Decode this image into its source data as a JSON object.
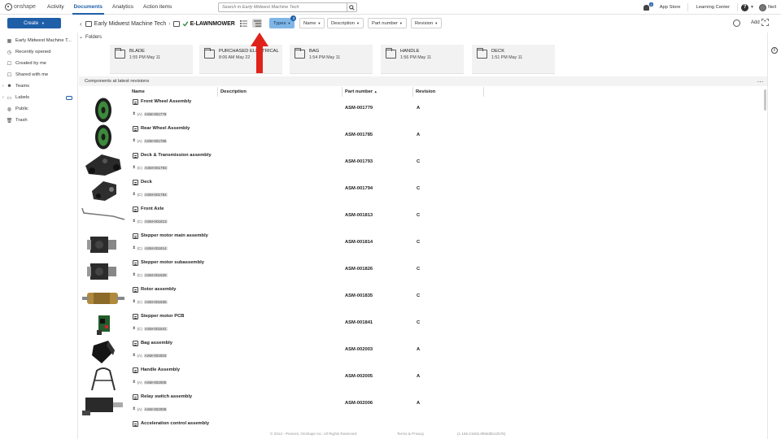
{
  "nav": {
    "logo": "onshape",
    "tabs": [
      "Activity",
      "Documents",
      "Analytics",
      "Action items"
    ],
    "active_tab": "Documents",
    "search_placeholder": "Search in Early Midwest Machine Tech",
    "notif_count": "8",
    "app_store": "App Store",
    "learning_center": "Learning Center",
    "help": "?",
    "user": "Neil"
  },
  "toolbar": {
    "create": "Create",
    "breadcrumb_root": "Early Midwest Machine Tech",
    "breadcrumb_current": "E-LAWNMOWER",
    "filters": {
      "types": "Types",
      "types_badge": "3",
      "name": "Name",
      "description": "Description",
      "part_number": "Part number",
      "revision": "Revision"
    },
    "add": "Add"
  },
  "sidebar": {
    "items": [
      {
        "label": "Early Midwest Machine T...",
        "icon": "building-icon"
      },
      {
        "label": "Recently opened",
        "icon": "clock-icon"
      },
      {
        "label": "Created by me",
        "icon": "person-icon"
      },
      {
        "label": "Shared with me",
        "icon": "shared-icon"
      },
      {
        "label": "Teams",
        "icon": "teams-icon"
      },
      {
        "label": "Labels",
        "icon": "label-icon"
      },
      {
        "label": "Public",
        "icon": "globe-icon"
      },
      {
        "label": "Trash",
        "icon": "trash-icon"
      }
    ]
  },
  "folders": {
    "heading": "Folders",
    "items": [
      {
        "name": "BLADE",
        "date": "1:55 PM May 11"
      },
      {
        "name": "PURCHASED ELECTRICAL",
        "date": "8:06 AM May 22"
      },
      {
        "name": "BAG",
        "date": "1:54 PM May 11"
      },
      {
        "name": "HANDLE",
        "date": "1:56 PM May 11"
      },
      {
        "name": "DECK",
        "date": "1:51 PM May 11"
      }
    ]
  },
  "components": {
    "heading": "Components at latest revisions",
    "more": "...",
    "columns": {
      "name": "Name",
      "description": "Description",
      "part_number": "Part number",
      "sort_indicator": "▲",
      "revision": "Revision"
    },
    "rows": [
      {
        "name": "Front Wheel Assembly",
        "rev_tag": "(A)",
        "pn_badge": "ASM-001779",
        "part_number": "ASM-001779",
        "revision": "A",
        "thumb": "wheel"
      },
      {
        "name": "Rear Wheel Assembly",
        "rev_tag": "(A)",
        "pn_badge": "ASM-001785",
        "part_number": "ASM-001785",
        "revision": "A",
        "thumb": "wheel"
      },
      {
        "name": "Deck & Transmission assembly",
        "rev_tag": "(C)",
        "pn_badge": "ASM-001793",
        "part_number": "ASM-001793",
        "revision": "C",
        "thumb": "deck"
      },
      {
        "name": "Deck",
        "rev_tag": "(C)",
        "pn_badge": "ASM-001794",
        "part_number": "ASM-001794",
        "revision": "C",
        "thumb": "deck2"
      },
      {
        "name": "Front Axle",
        "rev_tag": "(C)",
        "pn_badge": "ASM-001813",
        "part_number": "ASM-001813",
        "revision": "C",
        "thumb": "axle"
      },
      {
        "name": "Stepper motor main assembly",
        "rev_tag": "(C)",
        "pn_badge": "ASM-001814",
        "part_number": "ASM-001814",
        "revision": "C",
        "thumb": "motor"
      },
      {
        "name": "Stepper motor subassembly",
        "rev_tag": "(C)",
        "pn_badge": "ASM-001826",
        "part_number": "ASM-001826",
        "revision": "C",
        "thumb": "motor"
      },
      {
        "name": "Rotor assembly",
        "rev_tag": "(C)",
        "pn_badge": "ASM-001835",
        "part_number": "ASM-001835",
        "revision": "C",
        "thumb": "rotor"
      },
      {
        "name": "Stepper motor PCB",
        "rev_tag": "(C)",
        "pn_badge": "ASM-001841",
        "part_number": "ASM-001841",
        "revision": "C",
        "thumb": "pcb"
      },
      {
        "name": "Bag assembly",
        "rev_tag": "(A)",
        "pn_badge": "ASM-002003",
        "part_number": "ASM-002003",
        "revision": "A",
        "thumb": "bag"
      },
      {
        "name": "Handle Assembly",
        "rev_tag": "(A)",
        "pn_badge": "ASM-002005",
        "part_number": "ASM-002005",
        "revision": "A",
        "thumb": "handle"
      },
      {
        "name": "Relay switch assembly",
        "rev_tag": "(A)",
        "pn_badge": "ASM-002006",
        "part_number": "ASM-002006",
        "revision": "A",
        "thumb": "relay"
      },
      {
        "name": "Acceleration control assembly",
        "rev_tag": "",
        "pn_badge": "",
        "part_number": "",
        "revision": "",
        "thumb": "none"
      }
    ]
  },
  "footer": {
    "copyright": "© 2013 - Present, Onshape Inc. All Rights Reserved.",
    "terms": "Terms & Privacy",
    "version": "(1.169.21602.8f69d6b12b78)"
  },
  "colors": {
    "accent": "#1f5fa8",
    "types_filter": "#7fb6e6",
    "annotation_arrow": "#e0231a"
  }
}
